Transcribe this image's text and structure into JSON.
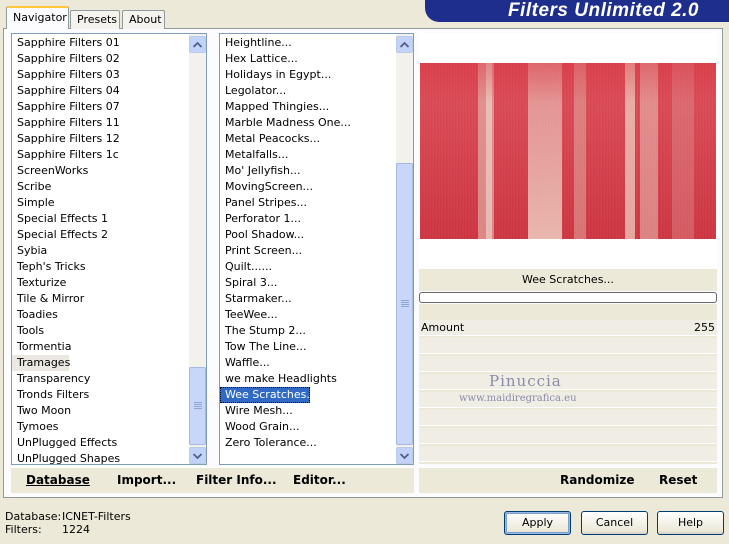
{
  "app": {
    "banner_title": "Filters Unlimited 2.0"
  },
  "tabs": [
    {
      "label": "Navigator",
      "active": true
    },
    {
      "label": "Presets",
      "active": false
    },
    {
      "label": "About",
      "active": false
    }
  ],
  "categories": {
    "items": [
      "Sapphire Filters 01",
      "Sapphire Filters 02",
      "Sapphire Filters 03",
      "Sapphire Filters 04",
      "Sapphire Filters 07",
      "Sapphire Filters 11",
      "Sapphire Filters 12",
      "Sapphire Filters 1c",
      "ScreenWorks",
      "Scribe",
      "Simple",
      "Special Effects 1",
      "Special Effects 2",
      "Sybia",
      "Teph's Tricks",
      "Texturize",
      "Tile & Mirror",
      "Toadies",
      "Tools",
      "Tormentia",
      "Tramages",
      "Transparency",
      "Tronds Filters",
      "Two Moon",
      "Tymoes",
      "UnPlugged Effects",
      "UnPlugged Shapes"
    ],
    "selected": "Tramages",
    "scroll_position": 0.93
  },
  "filters": {
    "items": [
      "Heightline...",
      "Hex Lattice...",
      "Holidays in Egypt...",
      "Legolator...",
      "Mapped Thingies...",
      "Marble Madness One...",
      "Metal Peacocks...",
      "Metalfalls...",
      "Mo' Jellyfish...",
      "MovingScreen...",
      "Panel Stripes...",
      "Perforator 1...",
      "Pool Shadow...",
      "Print Screen...",
      "Quilt......",
      "Spiral 3...",
      "Starmaker...",
      "TeeWee...",
      "The Stump 2...",
      "Tow The Line...",
      "Waffle...",
      "we make Headlights",
      "Wee Scratches...",
      "Wire Mesh...",
      "Wood Grain...",
      "Zero Tolerance..."
    ],
    "selected": "Wee Scratches...",
    "scroll_position": 1.0
  },
  "preview": {
    "filter_name": "Wee Scratches...",
    "progress": 0,
    "base_color": "#d6323f"
  },
  "sliders": [
    {
      "label": "Amount",
      "value": "255"
    }
  ],
  "watermark": {
    "name": "Pinuccia",
    "url": "www.maidiregrafica.eu"
  },
  "toolbar": {
    "database_label": "Database",
    "import_label": "Import...",
    "filter_info_label": "Filter Info...",
    "editor_label": "Editor...",
    "randomize_label": "Randomize",
    "reset_label": "Reset"
  },
  "status": {
    "database_key": "Database:",
    "database_value": "ICNET-Filters",
    "filters_key": "Filters:",
    "filters_value": "1224"
  },
  "buttons": {
    "apply": "Apply",
    "cancel": "Cancel",
    "help": "Help"
  }
}
